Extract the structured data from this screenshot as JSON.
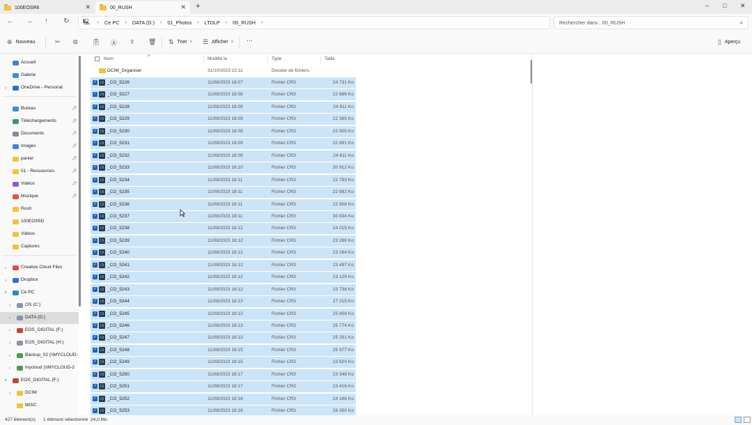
{
  "tabs": [
    {
      "title": "100EOSR6",
      "active": false
    },
    {
      "title": "00_RUSH",
      "active": true
    }
  ],
  "new_tab_glyph": "+",
  "window_controls": {
    "minimize": "–",
    "maximize": "□",
    "close": "✕"
  },
  "nav_icons": {
    "back": "←",
    "forward": "→",
    "up": "↑",
    "refresh": "↻",
    "pc": "🖳"
  },
  "breadcrumb": [
    "Ce PC",
    "DATA (D:)",
    "01_Photos",
    "LTDLP",
    "00_RUSH"
  ],
  "search": {
    "placeholder": "Rechercher dans : 00_RUSH"
  },
  "commands": {
    "new": "Nouveau",
    "sort": "Trier",
    "view": "Afficher",
    "more": "···",
    "preview": "Aperçu"
  },
  "sidebar": {
    "groups": [
      [
        {
          "label": "Accueil",
          "icon": "home-icon"
        },
        {
          "label": "Galerie",
          "icon": "gallery-icon"
        },
        {
          "label": "OneDrive - Personal",
          "icon": "cloud-icon",
          "expandable": true
        }
      ],
      [
        {
          "label": "Bureau",
          "icon": "desktop-icon",
          "pinned": true
        },
        {
          "label": "Téléchargements",
          "icon": "download-icon",
          "pinned": true
        },
        {
          "label": "Documents",
          "icon": "documents-icon",
          "pinned": true
        },
        {
          "label": "Images",
          "icon": "images-icon",
          "pinned": true
        },
        {
          "label": "panier",
          "icon": "folder-icon",
          "pinned": true
        },
        {
          "label": "01 - Ressources",
          "icon": "folder-icon",
          "pinned": true
        },
        {
          "label": "Vidéos",
          "icon": "videos-icon",
          "pinned": true
        },
        {
          "label": "Musique",
          "icon": "music-icon",
          "pinned": true
        },
        {
          "label": "Rush",
          "icon": "folder-icon"
        },
        {
          "label": "100EOS5D",
          "icon": "folder-icon"
        },
        {
          "label": "Vidéos",
          "icon": "folder-icon"
        },
        {
          "label": "Captures",
          "icon": "folder-icon"
        }
      ],
      [
        {
          "label": "Creative Cloud Files",
          "icon": "creative-cloud-icon",
          "expandable": true
        },
        {
          "label": "Dropbox",
          "icon": "dropbox-icon",
          "expandable": true
        },
        {
          "label": "Ce PC",
          "icon": "pc-icon",
          "expanded": true
        },
        {
          "label": "OS (C:)",
          "icon": "drive-icon",
          "expandable": true,
          "indent": 1
        },
        {
          "label": "DATA (D:)",
          "icon": "drive-icon",
          "expandable": true,
          "indent": 1,
          "selected": true
        },
        {
          "label": "EOS_DIGITAL (F:)",
          "icon": "usb-icon",
          "expandable": true,
          "indent": 1
        },
        {
          "label": "EOS_DIGITAL (H:)",
          "icon": "drive-icon",
          "expandable": true,
          "indent": 1
        },
        {
          "label": "Backup_02 (\\\\MYCLOUD-",
          "icon": "network-drive-icon",
          "expandable": true,
          "indent": 1
        },
        {
          "label": "mycloud (\\\\MYCLOUD-2",
          "icon": "network-drive-icon",
          "expandable": true,
          "indent": 1
        },
        {
          "label": "EOS_DIGITAL (F:)",
          "icon": "usb-icon",
          "expanded": true
        },
        {
          "label": "DCIM",
          "icon": "folder-icon",
          "expandable": true,
          "indent": 1
        },
        {
          "label": "MISC",
          "icon": "folder-icon",
          "indent": 1
        }
      ]
    ]
  },
  "columns": {
    "name": "Nom",
    "modified": "Modifié le",
    "type": "Type",
    "size": "Taille"
  },
  "folder_row": {
    "name": "DCIM_Organiser",
    "date": "31/10/2023 22:11",
    "type": "Dossier de fichiers",
    "size": ""
  },
  "file_icon_label": "CR",
  "files": [
    {
      "name": "_CO_5226",
      "date": "11/08/2023 18:07",
      "type": "Fichier CR3",
      "size": "24 731 Ko"
    },
    {
      "name": "_CO_5227",
      "date": "11/08/2023 18:08",
      "type": "Fichier CR3",
      "size": "22 686 Ko"
    },
    {
      "name": "_CO_5228",
      "date": "11/08/2023 18:09",
      "type": "Fichier CR3",
      "size": "24 911 Ko"
    },
    {
      "name": "_CO_5229",
      "date": "11/08/2023 18:09",
      "type": "Fichier CR3",
      "size": "22 365 Ko"
    },
    {
      "name": "_CO_5230",
      "date": "11/08/2023 18:09",
      "type": "Fichier CR3",
      "size": "22 905 Ko"
    },
    {
      "name": "_CO_5231",
      "date": "11/08/2023 18:09",
      "type": "Fichier CR3",
      "size": "22 891 Ko"
    },
    {
      "name": "_CO_5232",
      "date": "11/08/2023 18:09",
      "type": "Fichier CR3",
      "size": "24 611 Ko"
    },
    {
      "name": "_CO_5233",
      "date": "11/08/2023 18:10",
      "type": "Fichier CR3",
      "size": "30 912 Ko"
    },
    {
      "name": "_CO_5234",
      "date": "11/08/2023 18:11",
      "type": "Fichier CR3",
      "size": "22 793 Ko"
    },
    {
      "name": "_CO_5235",
      "date": "11/08/2023 18:11",
      "type": "Fichier CR3",
      "size": "22 892 Ko"
    },
    {
      "name": "_CO_5236",
      "date": "11/08/2023 18:11",
      "type": "Fichier CR3",
      "size": "22 908 Ko"
    },
    {
      "name": "_CO_5237",
      "date": "11/08/2023 18:11",
      "type": "Fichier CR3",
      "size": "30 834 Ko"
    },
    {
      "name": "_CO_5238",
      "date": "11/08/2023 18:12",
      "type": "Fichier CR3",
      "size": "24 015 Ko"
    },
    {
      "name": "_CO_5239",
      "date": "11/08/2023 18:12",
      "type": "Fichier CR3",
      "size": "23 266 Ko"
    },
    {
      "name": "_CO_5240",
      "date": "11/08/2023 18:12",
      "type": "Fichier CR3",
      "size": "23 264 Ko"
    },
    {
      "name": "_CO_5241",
      "date": "11/08/2023 18:12",
      "type": "Fichier CR3",
      "size": "23 497 Ko"
    },
    {
      "name": "_CO_5242",
      "date": "11/08/2023 18:12",
      "type": "Fichier CR3",
      "size": "23 129 Ko"
    },
    {
      "name": "_CO_5243",
      "date": "11/08/2023 18:12",
      "type": "Fichier CR3",
      "size": "23 738 Ko"
    },
    {
      "name": "_CO_5244",
      "date": "11/08/2023 18:13",
      "type": "Fichier CR3",
      "size": "27 215 Ko"
    },
    {
      "name": "_CO_5245",
      "date": "11/08/2023 18:13",
      "type": "Fichier CR3",
      "size": "25 809 Ko"
    },
    {
      "name": "_CO_5246",
      "date": "11/08/2023 18:13",
      "type": "Fichier CR3",
      "size": "25 774 Ko"
    },
    {
      "name": "_CO_5247",
      "date": "11/08/2023 18:13",
      "type": "Fichier CR3",
      "size": "25 291 Ko"
    },
    {
      "name": "_CO_5248",
      "date": "11/08/2023 18:15",
      "type": "Fichier CR3",
      "size": "25 977 Ko"
    },
    {
      "name": "_CO_5249",
      "date": "11/08/2023 18:15",
      "type": "Fichier CR3",
      "size": "23 620 Ko"
    },
    {
      "name": "_CO_5250",
      "date": "11/08/2023 18:17",
      "type": "Fichier CR3",
      "size": "23 349 Ko"
    },
    {
      "name": "_CO_5251",
      "date": "11/08/2023 18:17",
      "type": "Fichier CR3",
      "size": "23 416 Ko"
    },
    {
      "name": "_CO_5252",
      "date": "11/08/2023 18:18",
      "type": "Fichier CR3",
      "size": "24 188 Ko"
    },
    {
      "name": "_CO_5253",
      "date": "11/08/2023 18:18",
      "type": "Fichier CR3",
      "size": "28 350 Ko"
    }
  ],
  "status": {
    "count": "427 élément(s)",
    "selected": "1 élément sélectionné",
    "size": "24,0 Mo"
  },
  "colors": {
    "selection": "#cce4f7",
    "checkbox": "#1f62b5",
    "folder": "#f3c13a",
    "cr3_icon": "#2b3a4a"
  }
}
